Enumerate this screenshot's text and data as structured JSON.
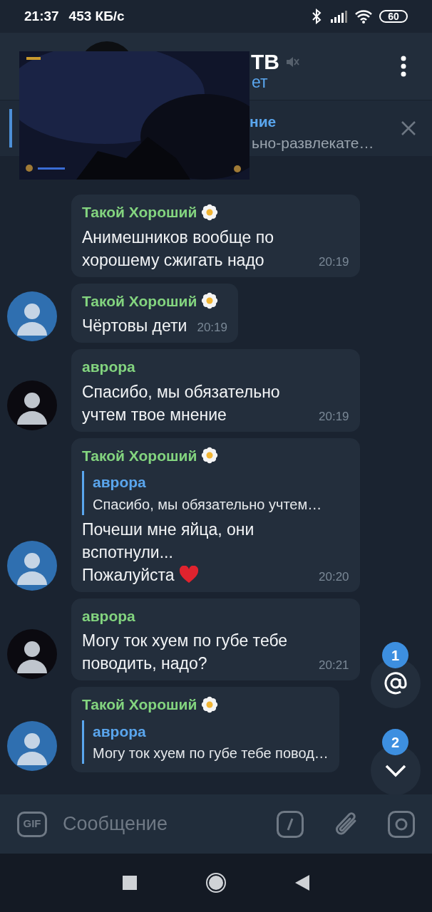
{
  "status_bar": {
    "time": "21:37",
    "speed": "453 КБ/с",
    "battery": "60"
  },
  "header": {
    "title": "ТВ",
    "muted": true,
    "subtitle": "ет"
  },
  "pinned": {
    "label": "ние",
    "text": "ьно-развлекате…"
  },
  "messages": [
    {
      "sender": "Такой Хороший",
      "flower": true,
      "show_avatar": false,
      "text": "Анимешников вообще по хорошему сжигать надо",
      "time": "20:19"
    },
    {
      "sender": "Такой Хороший",
      "flower": true,
      "color": "#2f6fb0",
      "show_avatar": true,
      "text": "Чёртовы дети",
      "time": "20:19"
    },
    {
      "sender": "аврора",
      "flower": false,
      "color": "#0b0a10",
      "show_avatar": true,
      "text": "Спасибо, мы обязательно учтем твое мнение",
      "time": "20:19"
    },
    {
      "sender": "Такой Хороший",
      "flower": true,
      "color": "#2f6fb0",
      "show_avatar": true,
      "reply": {
        "sender": "аврора",
        "text": "Спасибо, мы обязательно учтем…"
      },
      "text": "Почеши мне яйца, они вспотнули...",
      "text_2": "Пожалуйста",
      "heart": true,
      "time": "20:20"
    },
    {
      "sender": "аврора",
      "flower": false,
      "color": "#0b0a10",
      "show_avatar": true,
      "text": "Могу ток хуем по губе тебе поводить, надо?",
      "time": "20:21"
    },
    {
      "sender": "Такой Хороший",
      "flower": true,
      "color": "#2f6fb0",
      "show_avatar": true,
      "reply": {
        "sender": "аврора",
        "text": "Могу ток хуем по губе тебе повод…"
      }
    }
  ],
  "floating": [
    {
      "kind": "mention",
      "count": "1"
    },
    {
      "kind": "down",
      "count": "2"
    }
  ],
  "composer": {
    "gif": "GIF",
    "placeholder": "Сообщение"
  }
}
